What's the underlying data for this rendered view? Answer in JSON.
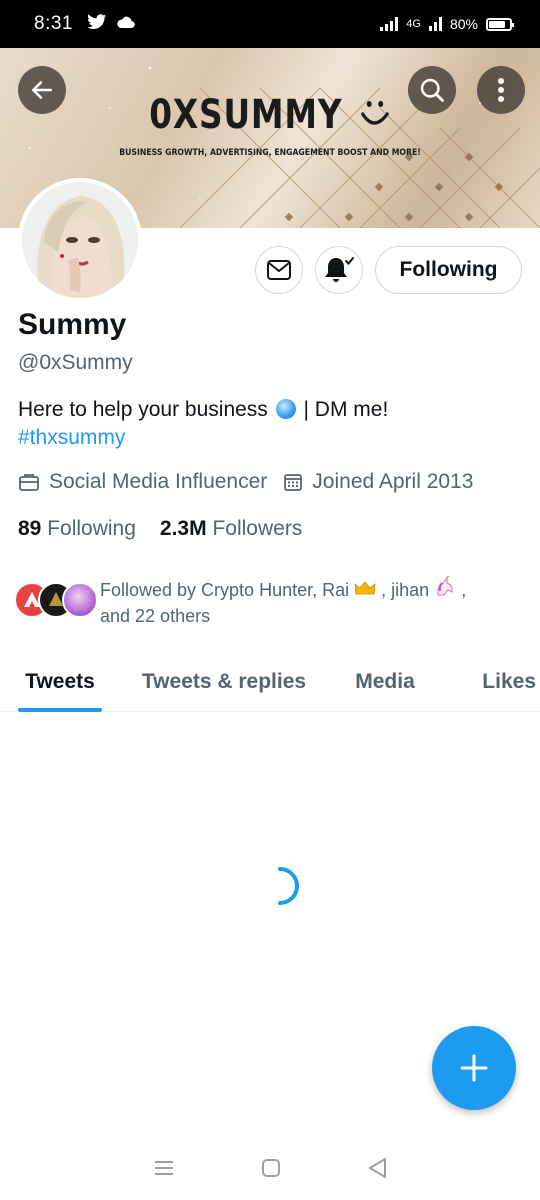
{
  "status_bar": {
    "time": "8:31",
    "network": "4G",
    "battery": "80%",
    "battery_level": 0.8,
    "icons": [
      "twitter-bird-icon",
      "cloud-icon",
      "signal-icon",
      "battery-icon"
    ]
  },
  "banner": {
    "title": "0XSUMMY",
    "subtitle": "BUSINESS GROWTH, ADVERTISING, ENGAGEMENT BOOST AND MORE!",
    "icons": [
      "back-arrow-icon",
      "search-icon",
      "more-vertical-icon",
      "smiley-icon"
    ]
  },
  "profile": {
    "name": "Summy",
    "handle": "@0xSummy",
    "bio_text": "Here to help your business",
    "bio_suffix": "| DM me!",
    "hashtag": "#thxsummy",
    "category": "Social Media Influencer",
    "joined": "Joined April 2013",
    "following_count": "89",
    "following_label": "Following",
    "followers_count": "2.3M",
    "followers_label": "Followers",
    "followed_by_prefix": "Followed by Crypto Hunter, Rai",
    "followed_by_mid": ", jihan",
    "followed_by_suffix": ",",
    "followed_by_line2": "and 22 others"
  },
  "actions": {
    "following_button": "Following",
    "icons": [
      "message-icon",
      "notification-bell-icon"
    ]
  },
  "tabs": [
    {
      "label": "Tweets",
      "active": true
    },
    {
      "label": "Tweets & replies",
      "active": false
    },
    {
      "label": "Media",
      "active": false
    },
    {
      "label": "Likes",
      "active": false
    }
  ],
  "colors": {
    "accent": "#1d9bf0",
    "text_primary": "#0f1419",
    "text_secondary": "#536471",
    "border": "#cfd9de"
  }
}
